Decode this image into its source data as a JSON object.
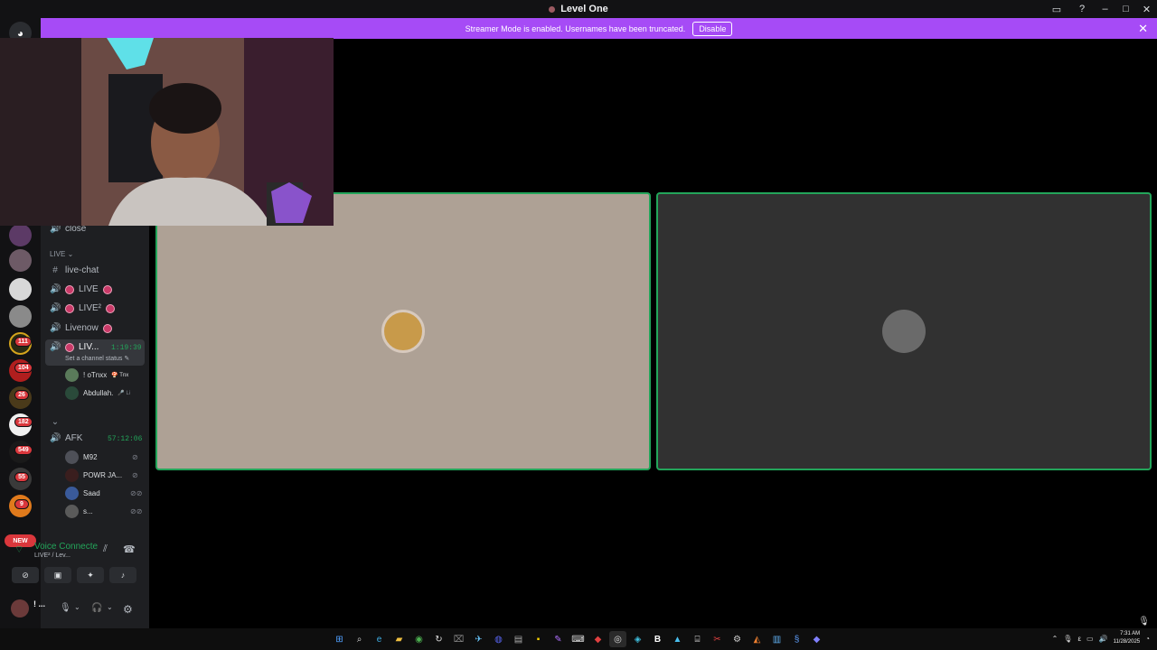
{
  "window": {
    "title": "Level One"
  },
  "streamer_bar": {
    "message": "Streamer Mode is enabled. Usernames have been truncated.",
    "disable_label": "Disable",
    "close_label": "✕"
  },
  "server_badges": [
    "111",
    "104",
    "26",
    "182",
    "549",
    "55",
    "9"
  ],
  "new_badge": "NEW",
  "channels": {
    "close": "close",
    "category_live": "LIVE ⌄",
    "live_chat": "live-chat",
    "live": "LIVE",
    "live2": "LIVE²",
    "livenow": "Livenow",
    "active": "LIV...",
    "active_timer": "1:19:39",
    "active_status": "Set a channel status ✎",
    "afk": "AFK",
    "afk_timer": "57:12:06"
  },
  "active_members": [
    {
      "name": "! oTnxx",
      "tag": "🍄 Tnx"
    },
    {
      "name": "Abdullah.",
      "tag": "🎤 Li"
    }
  ],
  "afk_members": [
    {
      "name": "M92"
    },
    {
      "name": "POWR JA..."
    },
    {
      "name": "Saad"
    },
    {
      "name": "s..."
    }
  ],
  "voice": {
    "title": "Voice Connecte",
    "subtitle": "LIVE² / Lev..."
  },
  "user": {
    "name": "! ..."
  },
  "clock": {
    "time": "7:31 AM",
    "date": "11/28/2025"
  },
  "colors": {
    "accent_streamer": "#a64bf6",
    "speaking_border": "#23a55a",
    "live_dot": "#c93a68"
  }
}
